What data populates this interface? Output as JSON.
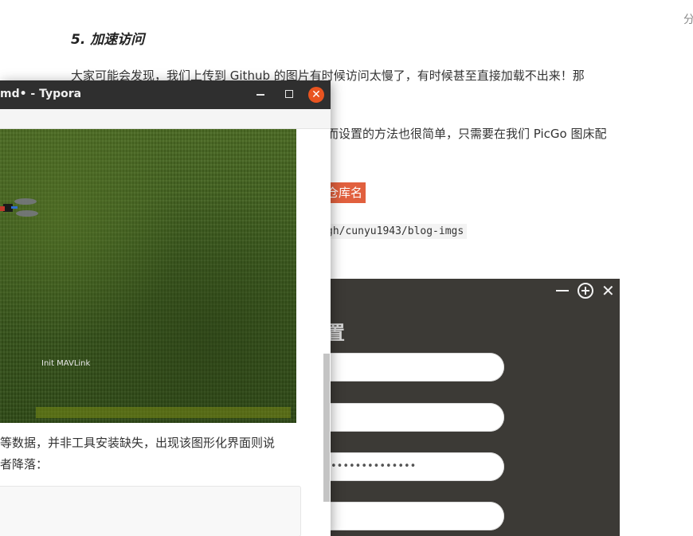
{
  "background_doc": {
    "share_label": "分",
    "heading": "5. 加速访问",
    "paragraph1": "大家可能会发现，我们上传到 Github 的图片有时候访问太慢了，有时候甚至直接加载不出来！那",
    "paragraph2": "而设置的方法也很简单，只需要在我们 PicGo 图床配",
    "highlight_tag": "仓库名",
    "inline_code": "gh/cunyu1943/blog-imgs"
  },
  "picgo_panel": {
    "title_fragment": "置",
    "close_glyph": "✕",
    "fields": [
      {
        "value": ""
      },
      {
        "value": ""
      },
      {
        "value": "••••••••••••••"
      },
      {
        "value": ""
      }
    ],
    "bg_color": "#3c3a36"
  },
  "typora_window": {
    "title": "md• - Typora",
    "close_glyph": "✕",
    "sim_status": "Init MAVLink",
    "text_line1": "等数据，并非工具安装缺失，出现该图形化界面则说",
    "text_line2": "者降落：",
    "close_color": "#e95420"
  }
}
